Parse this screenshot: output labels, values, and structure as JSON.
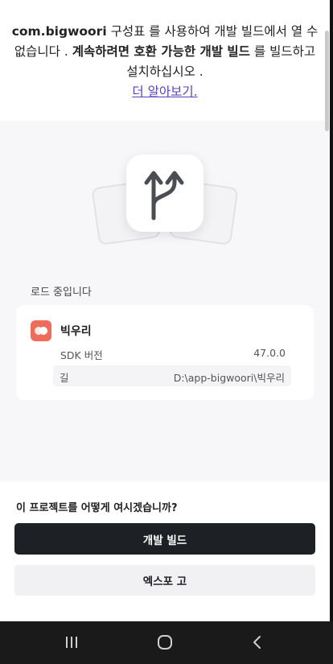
{
  "banner": {
    "part1": "com.bigwoori",
    "part2": " 구성표 를 사용하여 개발 빌드에서 열 수 없습니다 . ",
    "part3": "계속하려면 호환 가능한 개발 빌드",
    "part4": " 를 빌드하고 설치하십시오 .",
    "learn_more": "더 알아보기."
  },
  "loading": {
    "label": "로드 중입니다"
  },
  "project": {
    "name": "빅우리",
    "sdk_label": "SDK 버전",
    "sdk_value": "47.0.0",
    "path_label": "길",
    "path_value": "D:\\app-bigwoori\\빅우리",
    "icon_color": "#ef6b5a"
  },
  "sheet": {
    "question": "이 프로젝트를 어떻게 여시겠습니까?",
    "primary_label": "개발 빌드",
    "secondary_label": "엑스포 고"
  },
  "nav": {
    "recents": "recents-icon",
    "home": "home-icon",
    "back": "back-icon"
  },
  "colors": {
    "primary_button": "#1d2024",
    "link": "#5b3fbf"
  }
}
